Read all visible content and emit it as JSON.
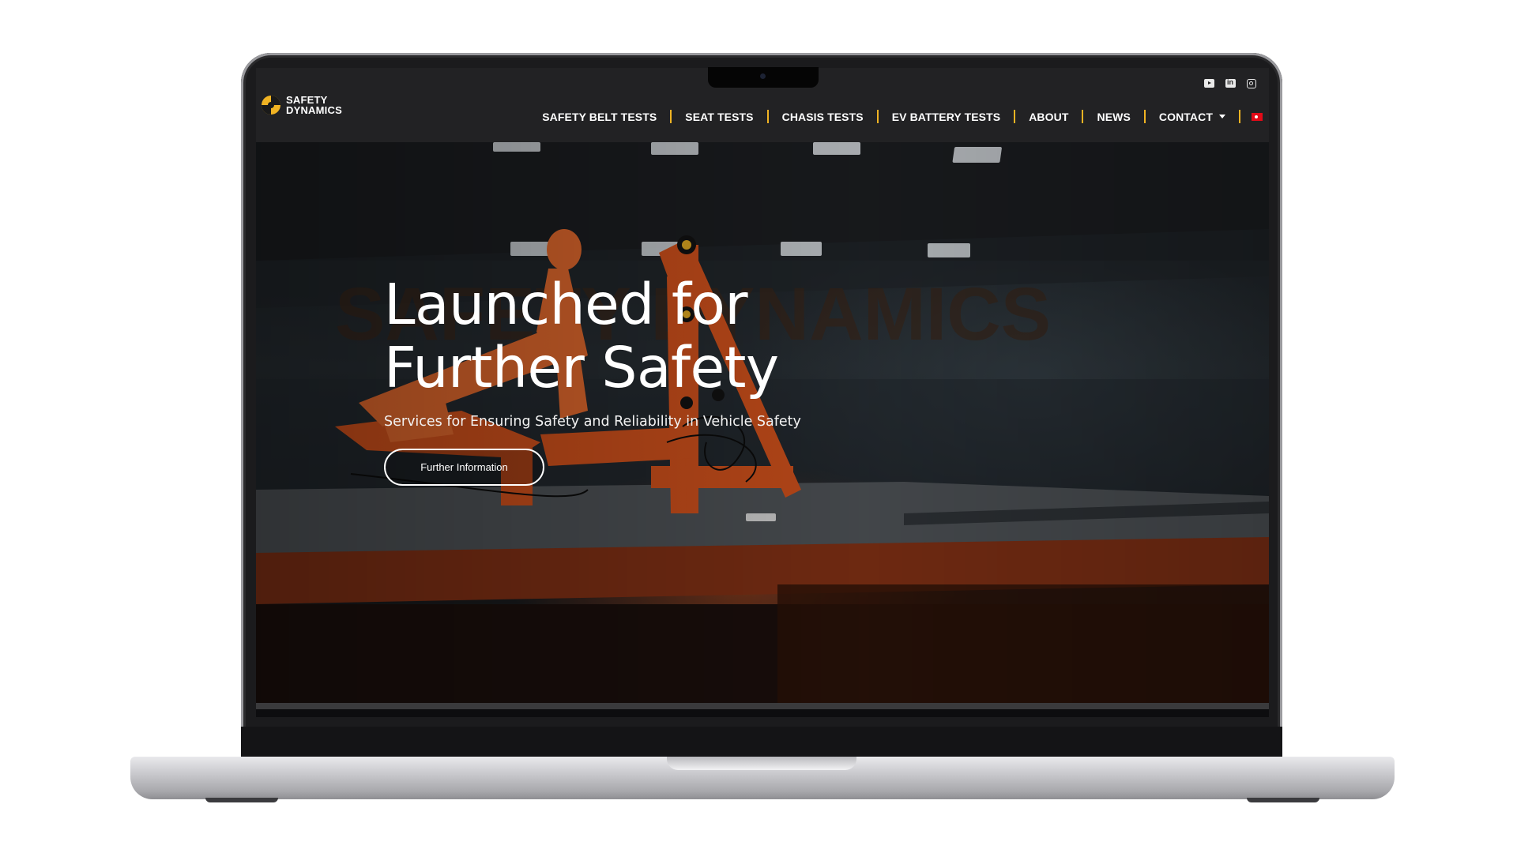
{
  "site": {
    "logo": {
      "line1": "SAFETY",
      "line2": "DYNAMICS"
    },
    "social": [
      "youtube-icon",
      "linkedin-icon",
      "instagram-icon"
    ],
    "nav": [
      {
        "label": "SAFETY BELT TESTS"
      },
      {
        "label": "SEAT TESTS"
      },
      {
        "label": "CHASIS TESTS"
      },
      {
        "label": "EV BATTERY TESTS"
      },
      {
        "label": "ABOUT"
      },
      {
        "label": "NEWS"
      },
      {
        "label": "CONTACT",
        "has_dropdown": true
      }
    ],
    "language_flag": "turkey-flag-icon",
    "hero": {
      "title_line1": "Launched for",
      "title_line2": "Further Safety",
      "subtitle": "Services for Ensuring Safety and Reliability in Vehicle Safety",
      "button_label": "Further Information"
    }
  },
  "colors": {
    "accent": "#f0b323",
    "header_bg": "#222224",
    "hero_orange": "#c44c1a",
    "laptop_silver": "#c9c9cd"
  }
}
